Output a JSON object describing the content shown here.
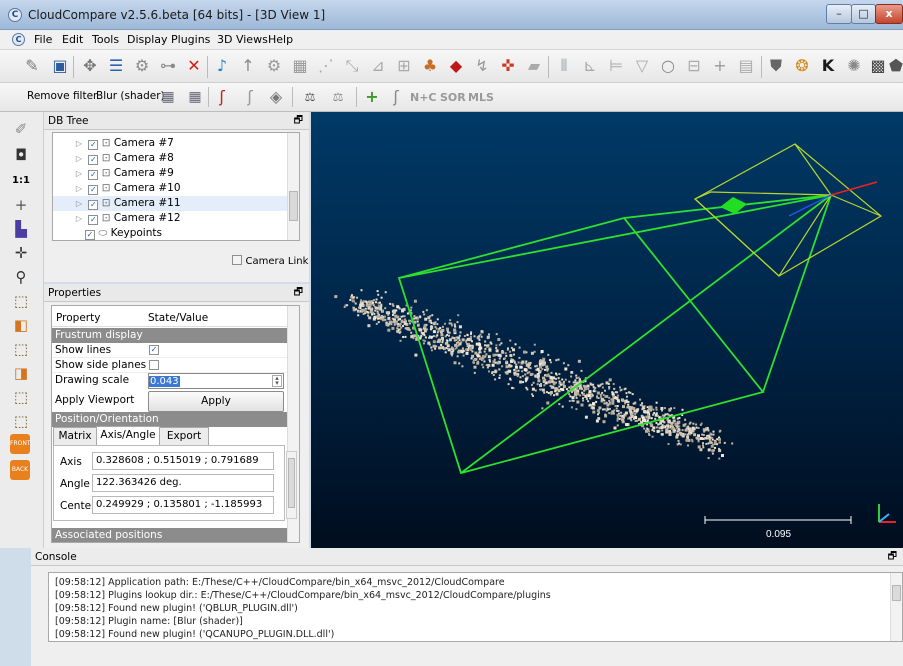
{
  "window": {
    "title": "CloudCompare v2.5.6.beta [64 bits] - [3D View 1]",
    "app_icon": "C",
    "min_label": "–",
    "max_label": "□",
    "close_label": "x"
  },
  "menu": {
    "items": [
      "File",
      "Edit",
      "Tools",
      "Display",
      "Plugins",
      "3D Views",
      "Help"
    ],
    "mdi_buttons": [
      "_",
      "▫",
      "×"
    ]
  },
  "toolbar2": {
    "remove_filter": "Remove filter",
    "blur_shader": "Blur (shader)",
    "nplus_c": "N+C",
    "sor": "SOR",
    "mls": "MLS"
  },
  "vtoolbar": {
    "one_to_one": "1:1",
    "front": "FRONT",
    "back": "BACK"
  },
  "dbtree": {
    "title": "DB Tree",
    "float_icon": "🗗",
    "items": [
      {
        "label": "Camera #7",
        "checked": "✓",
        "arrow": "▷"
      },
      {
        "label": "Camera #8",
        "checked": "✓",
        "arrow": "▷"
      },
      {
        "label": "Camera #9",
        "checked": "✓",
        "arrow": "▷"
      },
      {
        "label": "Camera #10",
        "checked": "✓",
        "arrow": "▷"
      },
      {
        "label": "Camera #11",
        "checked": "✓",
        "arrow": "▷"
      },
      {
        "label": "Camera #12",
        "checked": "✓",
        "arrow": "▷"
      },
      {
        "label": "Keypoints",
        "checked": "✓",
        "arrow": ""
      }
    ],
    "camera_link": "Camera Link"
  },
  "properties": {
    "title": "Properties",
    "col_property": "Property",
    "col_value": "State/Value",
    "frustum_section": "Frustrum display",
    "show_lines": "Show lines",
    "show_lines_check": "✓",
    "show_side_planes": "Show side planes",
    "drawing_scale": "Drawing scale",
    "drawing_scale_value": "0.043",
    "apply_viewport": "Apply Viewport",
    "apply_button": "Apply",
    "position_section": "Position/Orientation",
    "tabs": [
      "Matrix",
      "Axis/Angle",
      "Export"
    ],
    "axis_label": "Axis",
    "axis_value": "0.328608 ; 0.515019 ; 0.791689",
    "angle_label": "Angle",
    "angle_value": "122.363426 deg.",
    "center_label": "Center",
    "center_value": "0.249929 ; 0.135801 ; -1.185993",
    "associated_section": "Associated positions"
  },
  "view3d": {
    "scale_value": "0.095"
  },
  "console": {
    "title": "Console",
    "lines": [
      "[09:58:12] Application path: E:/These/C++/CloudCompare/bin_x64_msvc_2012/CloudCompare",
      "[09:58:12] Plugins lookup dir.: E:/These/C++/CloudCompare/bin_x64_msvc_2012/CloudCompare/plugins",
      "[09:58:12] Found new plugin! ('QBLUR_PLUGIN.dll')",
      "[09:58:12] Plugin name: [Blur (shader)]",
      "[09:58:12] Found new plugin! ('QCANUPO_PLUGIN.DLL.dll')"
    ]
  }
}
